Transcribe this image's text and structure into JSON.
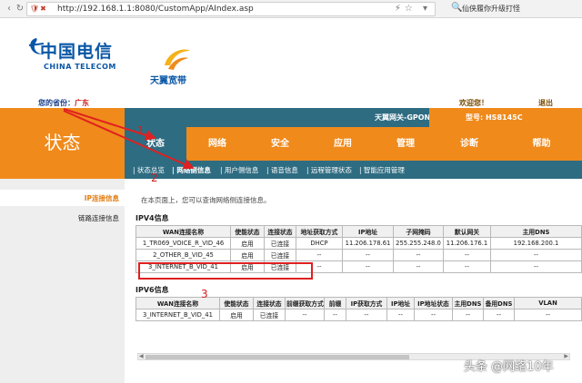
{
  "browser": {
    "url": "http://192.168.1.1:8080/CustomApp/AIndex.asp",
    "search_text": "仙侠履你升级打怪"
  },
  "header": {
    "logo_cn": "中国电信",
    "logo_en": "CHINA TELECOM",
    "logo2": "天翼宽带",
    "province_label": "您的省份：",
    "province_value": "广东",
    "welcome": "欢迎您！",
    "logout": "退出"
  },
  "status_title": "状态",
  "gateway": {
    "name": "天翼网关-GPON",
    "model": "型号: HS8145C"
  },
  "tabs": [
    {
      "label": "状态",
      "active": true
    },
    {
      "label": "网络"
    },
    {
      "label": "安全"
    },
    {
      "label": "应用"
    },
    {
      "label": "管理"
    },
    {
      "label": "诊断"
    },
    {
      "label": "帮助"
    }
  ],
  "subnav": [
    {
      "label": "| 状态总览"
    },
    {
      "label": "| 网络侧信息",
      "active": true
    },
    {
      "label": "| 用户侧信息"
    },
    {
      "label": "| 语音信息"
    },
    {
      "label": "| 远程管理状态"
    },
    {
      "label": "| 智能应用管理"
    }
  ],
  "sidebar": [
    {
      "label": "IP连接信息",
      "active": true
    },
    {
      "label": "链路连接信息"
    }
  ],
  "content": {
    "intro": "在本页面上，您可以查询网络侧连接信息。",
    "ipv4_title": "IPV4信息",
    "ipv6_title": "IPV6信息",
    "ipv4_headers": [
      "WAN连接名称",
      "使能状态",
      "连接状态",
      "地址获取方式",
      "IP地址",
      "子网掩码",
      "默认网关",
      "主用DNS"
    ],
    "ipv4_rows": [
      [
        "1_TR069_VOICE_R_VID_46",
        "启用",
        "已连接",
        "DHCP",
        "11.206.178.61",
        "255.255.248.0",
        "11.206.176.1",
        "192.168.200.1"
      ],
      [
        "2_OTHER_B_VID_45",
        "启用",
        "已连接",
        "--",
        "--",
        "--",
        "--",
        "--"
      ],
      [
        "3_INTERNET_B_VID_41",
        "启用",
        "已连接",
        "--",
        "--",
        "--",
        "--",
        "--"
      ]
    ],
    "ipv6_headers": [
      "WAN连接名称",
      "使能状态",
      "连接状态",
      "前缀获取方式",
      "前缀",
      "IP获取方式",
      "IP地址",
      "IP地址状态",
      "主用DNS",
      "备用DNS",
      "VLAN"
    ],
    "ipv6_rows": [
      [
        "3_INTERNET_B_VID_41",
        "启用",
        "已连接",
        "--",
        "--",
        "--",
        "--",
        "--",
        "--",
        "--",
        "--"
      ]
    ]
  },
  "annotations": [
    "1",
    "2",
    "3"
  ],
  "watermark": "头条 @网络10年",
  "colors": {
    "orange": "#f08a1b",
    "teal": "#2e6c82",
    "annotation_red": "#e02020"
  }
}
